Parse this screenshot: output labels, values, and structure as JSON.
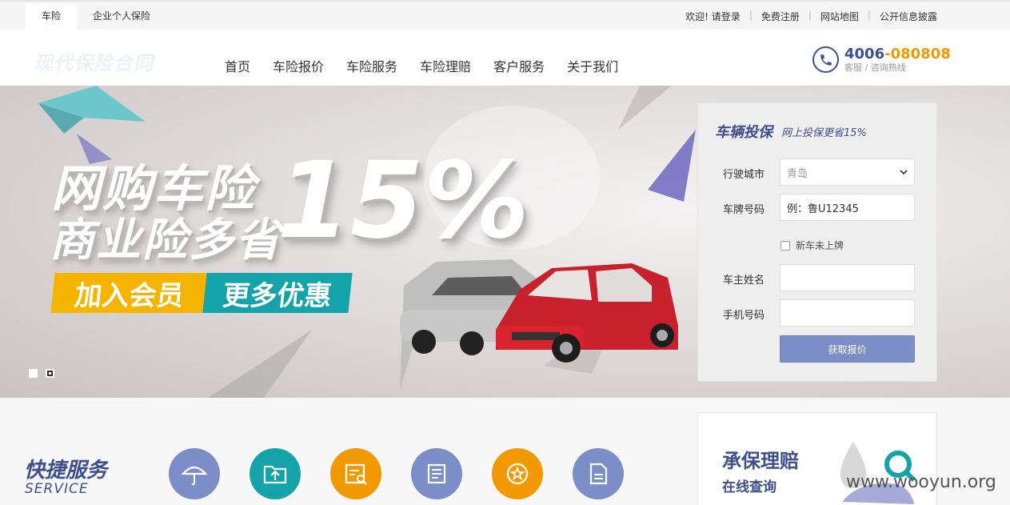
{
  "topbar": {
    "tabs": [
      "车险",
      "企业个人保险"
    ],
    "welcome": "欢迎! 请登录",
    "register": "免费注册",
    "sitemap": "网站地图",
    "disclosure": "公开信息披露"
  },
  "header": {
    "logo": "现代保险合同",
    "nav": [
      "首页",
      "车险报价",
      "车险服务",
      "车险理赔",
      "客户服务",
      "关于我们"
    ],
    "hotline_prefix": "4006",
    "hotline_suffix": "-080808",
    "hotline_label": "客服 / 咨询热线"
  },
  "banner": {
    "headline1": "网购车险",
    "headline2": "商业险多省",
    "percent": "15%",
    "join_label": "加入会员",
    "more_label": "更多优惠"
  },
  "quote_form": {
    "title": "车辆投保",
    "subtitle": "网上投保更省15%",
    "city_label": "行驶城市",
    "city_value": "青岛",
    "plate_label": "车牌号码",
    "plate_placeholder": "例：鲁U12345",
    "new_car_label": "新车未上牌",
    "owner_label": "车主姓名",
    "phone_label": "手机号码",
    "submit_label": "获取报价"
  },
  "services": {
    "title": "快捷服务",
    "subtitle": "SERVICE"
  },
  "claim": {
    "title": "承保理赔",
    "subtitle": "在线查询"
  },
  "watermark": "www.wooyun.org",
  "colors": {
    "brand_blue": "#3e4f8f",
    "accent_orange": "#f29800",
    "teal": "#13a3a8",
    "button_blue": "#7b8ec7"
  }
}
